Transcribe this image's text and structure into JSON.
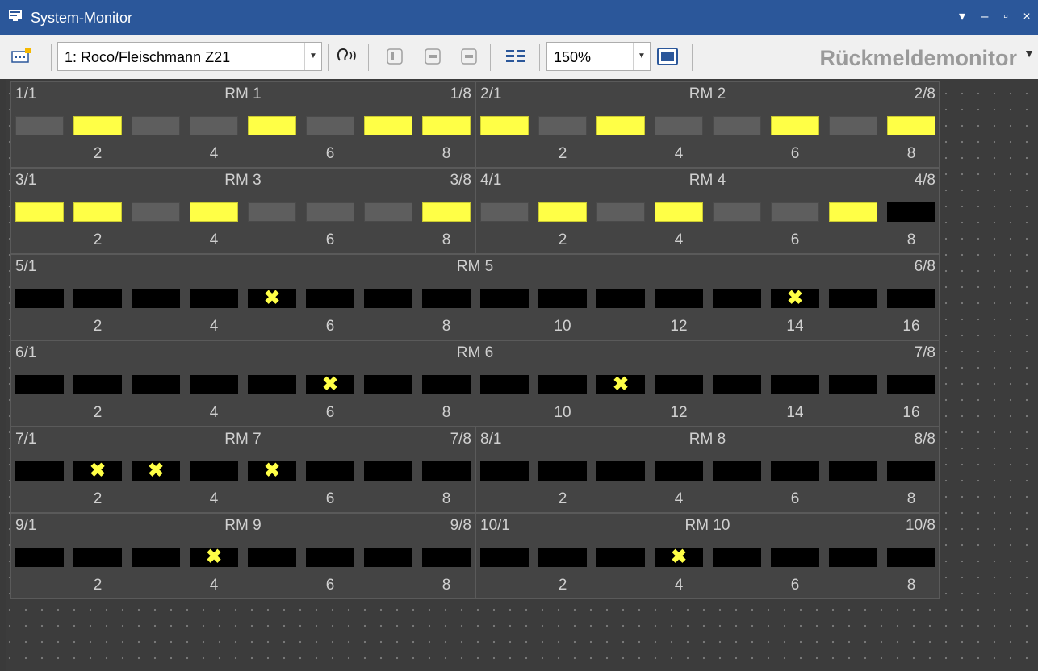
{
  "window": {
    "title": "System-Monitor",
    "dropdown_glyph": "▾",
    "minimize": "–",
    "maximize": "▫",
    "close": "×"
  },
  "toolbar": {
    "station": "1: Roco/Fleischmann Z21",
    "zoom": "150%",
    "view_label": "Rückmeldemonitor",
    "icons": [
      "station-settings-icon",
      "listen-icon",
      "prev-icon",
      "single-view-icon",
      "double-view-icon",
      "list-view-icon",
      "fullscreen-icon"
    ]
  },
  "colors": {
    "occupied": "#ffff46",
    "free": "#5e5e5e",
    "inactive": "#000000",
    "title_bar": "#2b579a"
  },
  "modules": [
    {
      "name": "RM 1",
      "start": "1/1",
      "end": "1/8",
      "ports": 8,
      "states": [
        "off",
        "on",
        "off",
        "off",
        "on",
        "off",
        "on",
        "on"
      ],
      "labels": [
        "2",
        "4",
        "6",
        "8"
      ]
    },
    {
      "name": "RM 2",
      "start": "2/1",
      "end": "2/8",
      "ports": 8,
      "states": [
        "on",
        "off",
        "on",
        "off",
        "off",
        "on",
        "off",
        "on"
      ],
      "labels": [
        "2",
        "4",
        "6",
        "8"
      ]
    },
    {
      "name": "RM 3",
      "start": "3/1",
      "end": "3/8",
      "ports": 8,
      "states": [
        "on",
        "on",
        "off",
        "on",
        "off",
        "off",
        "off",
        "on"
      ],
      "labels": [
        "2",
        "4",
        "6",
        "8"
      ]
    },
    {
      "name": "RM 4",
      "start": "4/1",
      "end": "4/8",
      "ports": 8,
      "states": [
        "off",
        "on",
        "off",
        "on",
        "off",
        "off",
        "on",
        "black"
      ],
      "labels": [
        "2",
        "4",
        "6",
        "8"
      ]
    },
    {
      "name": "RM 5",
      "start": "5/1",
      "end": "6/8",
      "ports": 16,
      "states": [
        "black",
        "black",
        "black",
        "black",
        "x",
        "black",
        "black",
        "black",
        "black",
        "black",
        "black",
        "black",
        "black",
        "x",
        "black",
        "black"
      ],
      "labels": [
        "2",
        "4",
        "6",
        "8",
        "10",
        "12",
        "14",
        "16"
      ]
    },
    {
      "name": "RM 6",
      "start": "6/1",
      "end": "7/8",
      "ports": 16,
      "states": [
        "black",
        "black",
        "black",
        "black",
        "black",
        "x",
        "black",
        "black",
        "black",
        "black",
        "x",
        "black",
        "black",
        "black",
        "black",
        "black"
      ],
      "labels": [
        "2",
        "4",
        "6",
        "8",
        "10",
        "12",
        "14",
        "16"
      ]
    },
    {
      "name": "RM 7",
      "start": "7/1",
      "end": "7/8",
      "ports": 8,
      "states": [
        "black",
        "x",
        "x",
        "black",
        "x",
        "black",
        "black",
        "black"
      ],
      "labels": [
        "2",
        "4",
        "6",
        "8"
      ]
    },
    {
      "name": "RM 8",
      "start": "8/1",
      "end": "8/8",
      "ports": 8,
      "states": [
        "black",
        "black",
        "black",
        "black",
        "black",
        "black",
        "black",
        "black"
      ],
      "labels": [
        "2",
        "4",
        "6",
        "8"
      ]
    },
    {
      "name": "RM 9",
      "start": "9/1",
      "end": "9/8",
      "ports": 8,
      "states": [
        "black",
        "black",
        "black",
        "x",
        "black",
        "black",
        "black",
        "black"
      ],
      "labels": [
        "2",
        "4",
        "6",
        "8"
      ]
    },
    {
      "name": "RM 10",
      "start": "10/1",
      "end": "10/8",
      "ports": 8,
      "states": [
        "black",
        "black",
        "black",
        "x",
        "black",
        "black",
        "black",
        "black"
      ],
      "labels": [
        "2",
        "4",
        "6",
        "8"
      ]
    }
  ]
}
